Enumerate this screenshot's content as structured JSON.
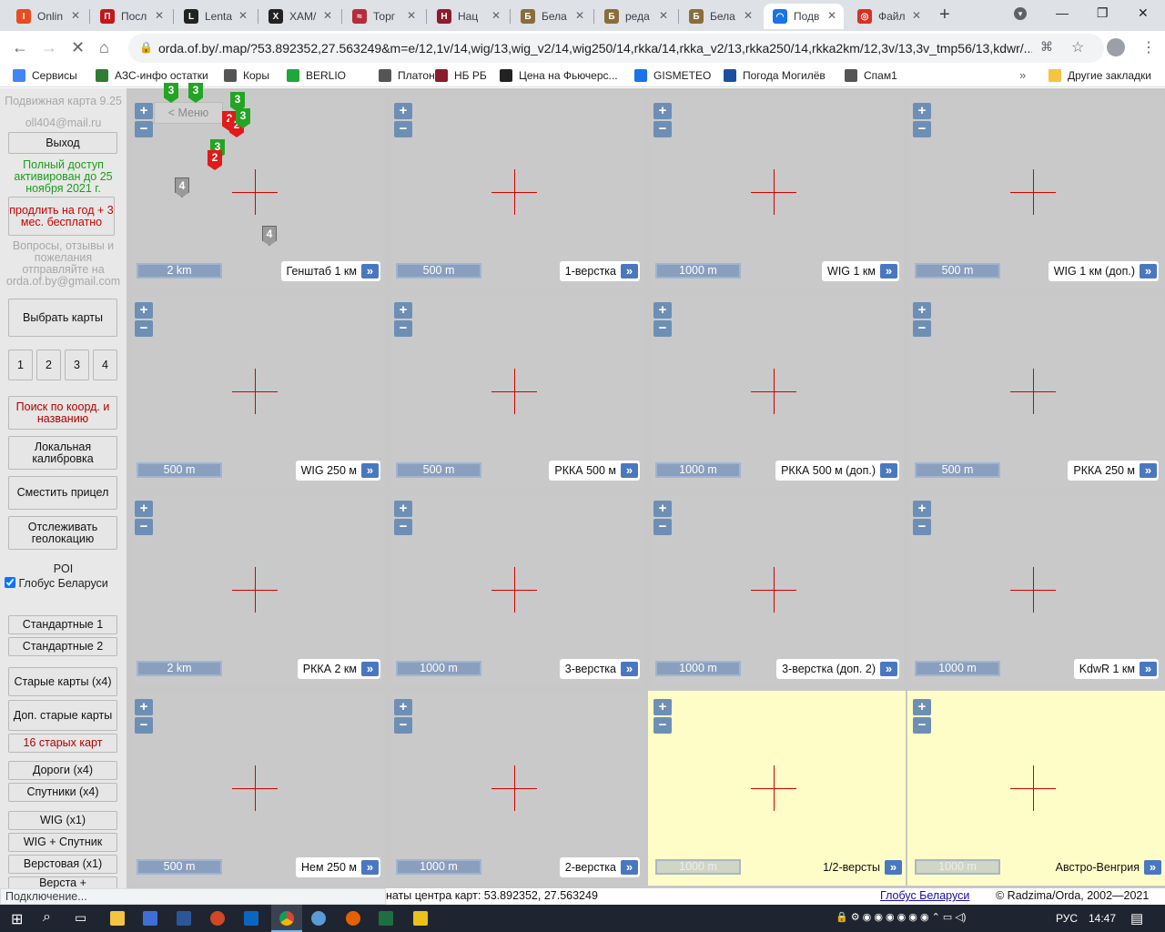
{
  "browser": {
    "tabs": [
      {
        "title": "Onlin",
        "fav": "I",
        "color": "#e84c1e"
      },
      {
        "title": "Посл",
        "fav": "П",
        "color": "#c4161c"
      },
      {
        "title": "Lenta",
        "fav": "L",
        "color": "#222"
      },
      {
        "title": "XAM/",
        "fav": "X",
        "color": "#222"
      },
      {
        "title": "Торг",
        "fav": "≈",
        "color": "#b52d3a"
      },
      {
        "title": "Нац",
        "fav": "Н",
        "color": "#8b1c2f"
      },
      {
        "title": "Бела",
        "fav": "Б",
        "color": "#8a6d3b"
      },
      {
        "title": "реда",
        "fav": "Б",
        "color": "#8a6d3b"
      },
      {
        "title": "Бела",
        "fav": "Б",
        "color": "#8a6d3b"
      },
      {
        "title": "Подв",
        "fav": "◠",
        "color": "#1a73e8"
      },
      {
        "title": "Файл",
        "fav": "◎",
        "color": "#d93025"
      }
    ],
    "url": "orda.of.by/.map/?53.892352,27.563249&m=e/12,1v/14,wig/13,wig_v2/14,wig250/14,rkka/14,rkka_v2/13,rkka250/14,rkka2km/12,3v/13,3v_tmp56/13,kdwr/...",
    "bookmarks": [
      {
        "label": "Сервисы",
        "color": "#4285f4",
        "icon": "apps-grid-icon"
      },
      {
        "label": "АЗС-инфо остатки",
        "color": "#2e7d32",
        "icon": "fuel-icon"
      },
      {
        "label": "Коры",
        "color": "#555",
        "icon": "globe-icon"
      },
      {
        "label": "BERLIO",
        "color": "#1fa83a",
        "icon": "berlio-icon"
      },
      {
        "label": "Платон",
        "color": "#555",
        "icon": "globe-icon"
      },
      {
        "label": "НБ РБ",
        "color": "#8b1c2f",
        "icon": "nbrb-icon"
      },
      {
        "label": "Цена на Фьючерс...",
        "color": "#222",
        "icon": "investing-icon"
      },
      {
        "label": "GISMETEO",
        "color": "#1a73e8",
        "icon": "drop-icon"
      },
      {
        "label": "Погода Могилёв",
        "color": "#1a4fa0",
        "icon": "weather-icon"
      },
      {
        "label": "Спам1",
        "color": "#555",
        "icon": "globe-icon"
      }
    ],
    "other_bookmarks": "Другие закладки"
  },
  "sidebar": {
    "app_version": "Подвижная карта 9.25",
    "user_email": "oll404@mail.ru",
    "logout": "Выход",
    "access_status": "Полный доступ активирован до 25 ноября 2021 г.",
    "extend_offer": "продлить на год + 3 мес. бесплатно",
    "feedback": "Вопросы, отзывы и пожелания отправляйте на orda.of.by@gmail.com",
    "select_maps": "Выбрать карты",
    "layouts": [
      "1",
      "2",
      "3",
      "4"
    ],
    "search": "Поиск по коорд. и названию",
    "local_calibration": "Локальная калибровка",
    "shift_crosshair": "Сместить прицел",
    "track_geolocation": "Отслеживать геолокацию",
    "poi_label": "POI",
    "poi_checkbox": "Глобус Беларуси",
    "presets": [
      "Стандартные 1",
      "Стандартные 2",
      "Старые карты (x4)",
      "Доп. старые карты",
      "16 старых карт",
      "Дороги (x4)",
      "Спутники (x4)",
      "WIG (x1)",
      "WIG + Спутник",
      "Верстовая (x1)",
      "Верста +"
    ],
    "menu_button": "< Меню"
  },
  "maps": [
    {
      "scale": "2 km",
      "name": "Генштаб 1 км"
    },
    {
      "scale": "500 m",
      "name": "1-верстка"
    },
    {
      "scale": "1000 m",
      "name": "WIG 1 км"
    },
    {
      "scale": "500 m",
      "name": "WIG 1 км (доп.)"
    },
    {
      "scale": "500 m",
      "name": "WIG 250 м"
    },
    {
      "scale": "500 m",
      "name": "РККА 500 м"
    },
    {
      "scale": "1000 m",
      "name": "РККА 500 м (доп.)"
    },
    {
      "scale": "500 m",
      "name": "РККА 250 м"
    },
    {
      "scale": "2 km",
      "name": "РККА 2 км"
    },
    {
      "scale": "1000 m",
      "name": "3-верстка"
    },
    {
      "scale": "1000 m",
      "name": "3-верстка (доп. 2)"
    },
    {
      "scale": "1000 m",
      "name": "KdwR 1 км"
    },
    {
      "scale": "500 m",
      "name": "Нем 250 м"
    },
    {
      "scale": "1000 m",
      "name": "2-верстка"
    },
    {
      "scale": "1000 m",
      "name": "1/2-версты"
    },
    {
      "scale": "1000 m",
      "name": "Австро-Венгрия"
    }
  ],
  "zoom": {
    "in": "+",
    "out": "−",
    "go": "»"
  },
  "pins": [
    "3",
    "3",
    "3",
    "2",
    "2",
    "3",
    "3",
    "2",
    "4",
    "4"
  ],
  "status": {
    "loading": "Подключение...",
    "coords": "наты центра карт: 53.892352, 27.563249",
    "globe_link": "Глобус Беларуси",
    "copyright": "© Radzima/Orda, 2002—2021"
  },
  "taskbar": {
    "lang": "РУС",
    "time": "14:47"
  }
}
